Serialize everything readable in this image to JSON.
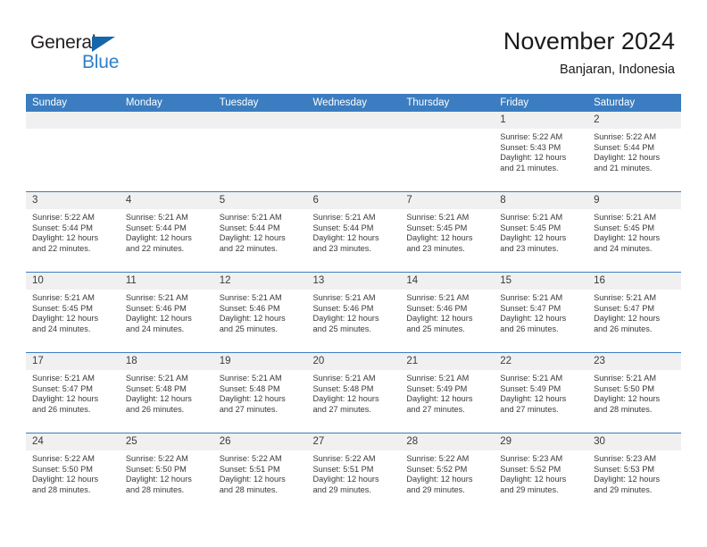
{
  "brand": {
    "line1": "General",
    "line2": "Blue",
    "triangle_color": "#1566ac",
    "blue_color": "#2f80c8"
  },
  "header": {
    "title": "November 2024",
    "subtitle": "Banjaran, Indonesia"
  },
  "theme": {
    "header_row_bg": "#3b7dc0",
    "daynum_band_bg": "#f0f0f0",
    "grid_line": "#3b7dc0",
    "text": "#3a3a3a"
  },
  "weekday_headers": [
    "Sunday",
    "Monday",
    "Tuesday",
    "Wednesday",
    "Thursday",
    "Friday",
    "Saturday"
  ],
  "weeks": [
    [
      {
        "day": "",
        "empty": true,
        "sunrise": "",
        "sunset": "",
        "daylight1": "",
        "daylight2": ""
      },
      {
        "day": "",
        "empty": true,
        "sunrise": "",
        "sunset": "",
        "daylight1": "",
        "daylight2": ""
      },
      {
        "day": "",
        "empty": true,
        "sunrise": "",
        "sunset": "",
        "daylight1": "",
        "daylight2": ""
      },
      {
        "day": "",
        "empty": true,
        "sunrise": "",
        "sunset": "",
        "daylight1": "",
        "daylight2": ""
      },
      {
        "day": "",
        "empty": true,
        "sunrise": "",
        "sunset": "",
        "daylight1": "",
        "daylight2": ""
      },
      {
        "day": "1",
        "empty": false,
        "sunrise": "Sunrise: 5:22 AM",
        "sunset": "Sunset: 5:43 PM",
        "daylight1": "Daylight: 12 hours",
        "daylight2": "and 21 minutes."
      },
      {
        "day": "2",
        "empty": false,
        "sunrise": "Sunrise: 5:22 AM",
        "sunset": "Sunset: 5:44 PM",
        "daylight1": "Daylight: 12 hours",
        "daylight2": "and 21 minutes."
      }
    ],
    [
      {
        "day": "3",
        "empty": false,
        "sunrise": "Sunrise: 5:22 AM",
        "sunset": "Sunset: 5:44 PM",
        "daylight1": "Daylight: 12 hours",
        "daylight2": "and 22 minutes."
      },
      {
        "day": "4",
        "empty": false,
        "sunrise": "Sunrise: 5:21 AM",
        "sunset": "Sunset: 5:44 PM",
        "daylight1": "Daylight: 12 hours",
        "daylight2": "and 22 minutes."
      },
      {
        "day": "5",
        "empty": false,
        "sunrise": "Sunrise: 5:21 AM",
        "sunset": "Sunset: 5:44 PM",
        "daylight1": "Daylight: 12 hours",
        "daylight2": "and 22 minutes."
      },
      {
        "day": "6",
        "empty": false,
        "sunrise": "Sunrise: 5:21 AM",
        "sunset": "Sunset: 5:44 PM",
        "daylight1": "Daylight: 12 hours",
        "daylight2": "and 23 minutes."
      },
      {
        "day": "7",
        "empty": false,
        "sunrise": "Sunrise: 5:21 AM",
        "sunset": "Sunset: 5:45 PM",
        "daylight1": "Daylight: 12 hours",
        "daylight2": "and 23 minutes."
      },
      {
        "day": "8",
        "empty": false,
        "sunrise": "Sunrise: 5:21 AM",
        "sunset": "Sunset: 5:45 PM",
        "daylight1": "Daylight: 12 hours",
        "daylight2": "and 23 minutes."
      },
      {
        "day": "9",
        "empty": false,
        "sunrise": "Sunrise: 5:21 AM",
        "sunset": "Sunset: 5:45 PM",
        "daylight1": "Daylight: 12 hours",
        "daylight2": "and 24 minutes."
      }
    ],
    [
      {
        "day": "10",
        "empty": false,
        "sunrise": "Sunrise: 5:21 AM",
        "sunset": "Sunset: 5:45 PM",
        "daylight1": "Daylight: 12 hours",
        "daylight2": "and 24 minutes."
      },
      {
        "day": "11",
        "empty": false,
        "sunrise": "Sunrise: 5:21 AM",
        "sunset": "Sunset: 5:46 PM",
        "daylight1": "Daylight: 12 hours",
        "daylight2": "and 24 minutes."
      },
      {
        "day": "12",
        "empty": false,
        "sunrise": "Sunrise: 5:21 AM",
        "sunset": "Sunset: 5:46 PM",
        "daylight1": "Daylight: 12 hours",
        "daylight2": "and 25 minutes."
      },
      {
        "day": "13",
        "empty": false,
        "sunrise": "Sunrise: 5:21 AM",
        "sunset": "Sunset: 5:46 PM",
        "daylight1": "Daylight: 12 hours",
        "daylight2": "and 25 minutes."
      },
      {
        "day": "14",
        "empty": false,
        "sunrise": "Sunrise: 5:21 AM",
        "sunset": "Sunset: 5:46 PM",
        "daylight1": "Daylight: 12 hours",
        "daylight2": "and 25 minutes."
      },
      {
        "day": "15",
        "empty": false,
        "sunrise": "Sunrise: 5:21 AM",
        "sunset": "Sunset: 5:47 PM",
        "daylight1": "Daylight: 12 hours",
        "daylight2": "and 26 minutes."
      },
      {
        "day": "16",
        "empty": false,
        "sunrise": "Sunrise: 5:21 AM",
        "sunset": "Sunset: 5:47 PM",
        "daylight1": "Daylight: 12 hours",
        "daylight2": "and 26 minutes."
      }
    ],
    [
      {
        "day": "17",
        "empty": false,
        "sunrise": "Sunrise: 5:21 AM",
        "sunset": "Sunset: 5:47 PM",
        "daylight1": "Daylight: 12 hours",
        "daylight2": "and 26 minutes."
      },
      {
        "day": "18",
        "empty": false,
        "sunrise": "Sunrise: 5:21 AM",
        "sunset": "Sunset: 5:48 PM",
        "daylight1": "Daylight: 12 hours",
        "daylight2": "and 26 minutes."
      },
      {
        "day": "19",
        "empty": false,
        "sunrise": "Sunrise: 5:21 AM",
        "sunset": "Sunset: 5:48 PM",
        "daylight1": "Daylight: 12 hours",
        "daylight2": "and 27 minutes."
      },
      {
        "day": "20",
        "empty": false,
        "sunrise": "Sunrise: 5:21 AM",
        "sunset": "Sunset: 5:48 PM",
        "daylight1": "Daylight: 12 hours",
        "daylight2": "and 27 minutes."
      },
      {
        "day": "21",
        "empty": false,
        "sunrise": "Sunrise: 5:21 AM",
        "sunset": "Sunset: 5:49 PM",
        "daylight1": "Daylight: 12 hours",
        "daylight2": "and 27 minutes."
      },
      {
        "day": "22",
        "empty": false,
        "sunrise": "Sunrise: 5:21 AM",
        "sunset": "Sunset: 5:49 PM",
        "daylight1": "Daylight: 12 hours",
        "daylight2": "and 27 minutes."
      },
      {
        "day": "23",
        "empty": false,
        "sunrise": "Sunrise: 5:21 AM",
        "sunset": "Sunset: 5:50 PM",
        "daylight1": "Daylight: 12 hours",
        "daylight2": "and 28 minutes."
      }
    ],
    [
      {
        "day": "24",
        "empty": false,
        "sunrise": "Sunrise: 5:22 AM",
        "sunset": "Sunset: 5:50 PM",
        "daylight1": "Daylight: 12 hours",
        "daylight2": "and 28 minutes."
      },
      {
        "day": "25",
        "empty": false,
        "sunrise": "Sunrise: 5:22 AM",
        "sunset": "Sunset: 5:50 PM",
        "daylight1": "Daylight: 12 hours",
        "daylight2": "and 28 minutes."
      },
      {
        "day": "26",
        "empty": false,
        "sunrise": "Sunrise: 5:22 AM",
        "sunset": "Sunset: 5:51 PM",
        "daylight1": "Daylight: 12 hours",
        "daylight2": "and 28 minutes."
      },
      {
        "day": "27",
        "empty": false,
        "sunrise": "Sunrise: 5:22 AM",
        "sunset": "Sunset: 5:51 PM",
        "daylight1": "Daylight: 12 hours",
        "daylight2": "and 29 minutes."
      },
      {
        "day": "28",
        "empty": false,
        "sunrise": "Sunrise: 5:22 AM",
        "sunset": "Sunset: 5:52 PM",
        "daylight1": "Daylight: 12 hours",
        "daylight2": "and 29 minutes."
      },
      {
        "day": "29",
        "empty": false,
        "sunrise": "Sunrise: 5:23 AM",
        "sunset": "Sunset: 5:52 PM",
        "daylight1": "Daylight: 12 hours",
        "daylight2": "and 29 minutes."
      },
      {
        "day": "30",
        "empty": false,
        "sunrise": "Sunrise: 5:23 AM",
        "sunset": "Sunset: 5:53 PM",
        "daylight1": "Daylight: 12 hours",
        "daylight2": "and 29 minutes."
      }
    ]
  ]
}
